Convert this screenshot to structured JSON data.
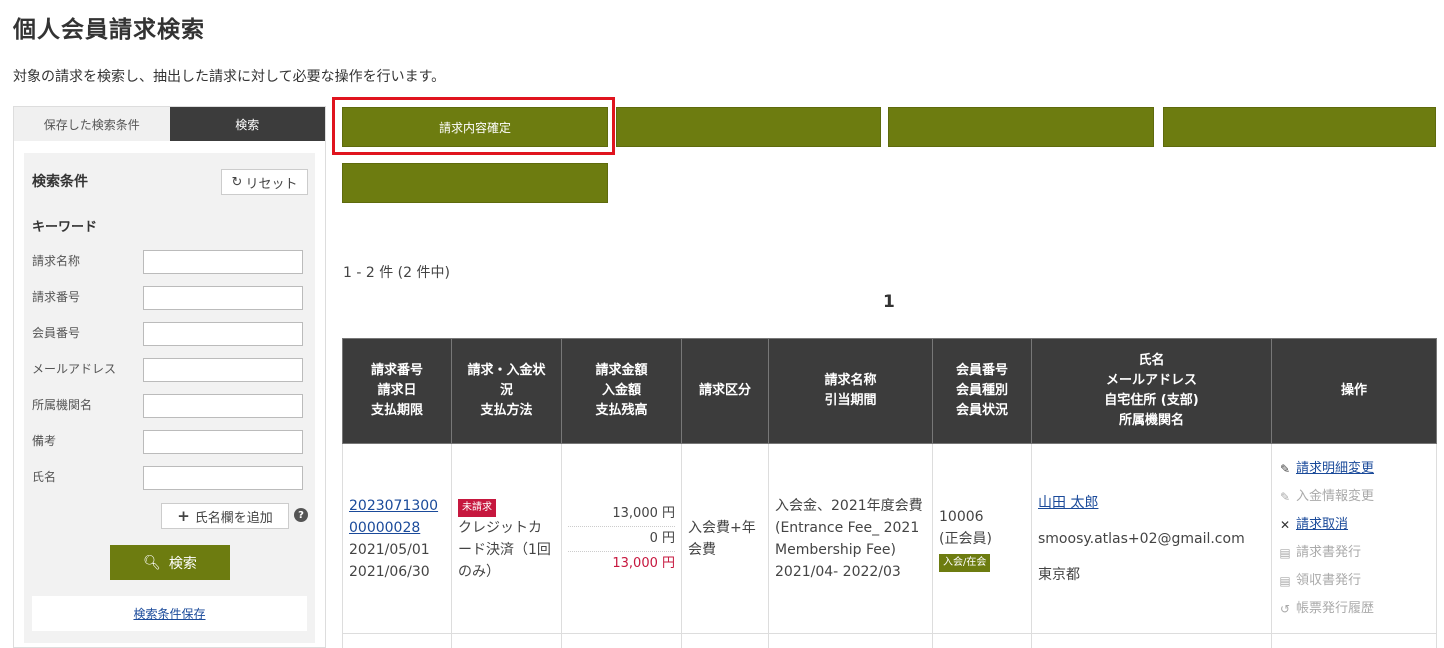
{
  "page": {
    "title": "個人会員請求検索",
    "description": "対象の請求を検索し、抽出した請求に対して必要な操作を行います。"
  },
  "sidebar": {
    "tabs": [
      "保存した検索条件",
      "検索"
    ],
    "condition_title": "検索条件",
    "reset_label": "リセット",
    "keyword_label": "キーワード",
    "fields": [
      {
        "label": "請求名称",
        "value": ""
      },
      {
        "label": "請求番号",
        "value": ""
      },
      {
        "label": "会員番号",
        "value": ""
      },
      {
        "label": "メールアドレス",
        "value": ""
      },
      {
        "label": "所属機関名",
        "value": ""
      },
      {
        "label": "備考",
        "value": ""
      },
      {
        "label": "氏名",
        "value": ""
      }
    ],
    "add_name_label": "氏名欄を追加",
    "search_label": "検索",
    "save_condition_label": "検索条件保存"
  },
  "actions": {
    "confirm_label": "請求内容確定",
    "btn2_label": "",
    "btn3_label": "",
    "btn4_label": "",
    "btn5_label": ""
  },
  "results": {
    "count_text": "1 - 2 件 (2 件中)",
    "page": "1",
    "headers": [
      [
        "請求番号",
        "請求日",
        "支払期限"
      ],
      [
        "請求・入金状",
        "況",
        "支払方法"
      ],
      [
        "請求金額",
        "入金額",
        "支払残高"
      ],
      [
        "請求区分"
      ],
      [
        "請求名称",
        "引当期間"
      ],
      [
        "会員番号",
        "会員種別",
        "会員状況"
      ],
      [
        "氏名",
        "メールアドレス",
        "自宅住所 (支部)",
        "所属機関名"
      ],
      [
        "操作"
      ]
    ],
    "row": {
      "invoice_no_1": "2023071300",
      "invoice_no_2": "00000028",
      "invoice_date": "2021/05/01",
      "due_date": "2021/06/30",
      "status_badge": "未請求",
      "payment_method": "クレジットカード決済（1回のみ）",
      "amount_billed": "13,000 円",
      "amount_paid": "0 円",
      "amount_balance": "13,000 円",
      "category": "入会費+年会費",
      "invoice_name": "入会金、2021年度会費",
      "invoice_name_en": "(Entrance Fee_ 2021 Membership Fee)",
      "period": "2021/04- 2022/03",
      "member_no": "10006",
      "member_type": "(正会員)",
      "member_status_badge": "入会/在会",
      "name": "山田 太郎",
      "email": "smoosy.atlas+02@gmail.com",
      "address": "東京都",
      "operations": [
        {
          "label": "請求明細変更",
          "icon": "pencil-icon",
          "enabled": true
        },
        {
          "label": "入金情報変更",
          "icon": "pencil-icon",
          "enabled": false
        },
        {
          "label": "請求取消",
          "icon": "x-icon",
          "enabled": true
        },
        {
          "label": "請求書発行",
          "icon": "document-icon",
          "enabled": false
        },
        {
          "label": "領収書発行",
          "icon": "document-icon",
          "enabled": false
        },
        {
          "label": "帳票発行履歴",
          "icon": "history-icon",
          "enabled": false
        }
      ]
    }
  },
  "colors": {
    "olive": "#6d7c10",
    "header_dark": "#3c3c3c",
    "highlight_red": "#e0141e",
    "badge_red": "#c6173e",
    "link_blue": "#1a4a9a"
  }
}
